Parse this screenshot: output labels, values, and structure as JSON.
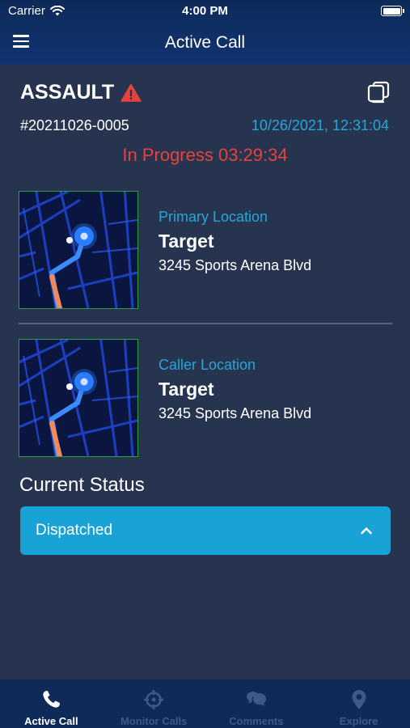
{
  "status_bar": {
    "carrier": "Carrier",
    "time": "4:00 PM"
  },
  "nav": {
    "title": "Active Call"
  },
  "incident": {
    "type": "ASSAULT",
    "id": "#20211026-0005",
    "datetime": "10/26/2021, 12:31:04",
    "status": "In Progress 03:29:34"
  },
  "locations": [
    {
      "label": "Primary Location",
      "name": "Target",
      "address": "3245 Sports Arena Blvd"
    },
    {
      "label": "Caller Location",
      "name": "Target",
      "address": "3245 Sports Arena Blvd"
    }
  ],
  "current_status": {
    "heading": "Current Status",
    "value": "Dispatched"
  },
  "tabs": [
    {
      "label": "Active Call",
      "icon": "phone-icon",
      "active": true
    },
    {
      "label": "Monitor Calls",
      "icon": "crosshair-icon",
      "active": false
    },
    {
      "label": "Comments",
      "icon": "chat-icon",
      "active": false
    },
    {
      "label": "Explore",
      "icon": "map-pin-icon",
      "active": false
    }
  ],
  "colors": {
    "background": "#27344f",
    "header": "#0d2a59",
    "accent": "#27a5d8",
    "alert": "#e8423c",
    "dropdown": "#19a2d6"
  }
}
